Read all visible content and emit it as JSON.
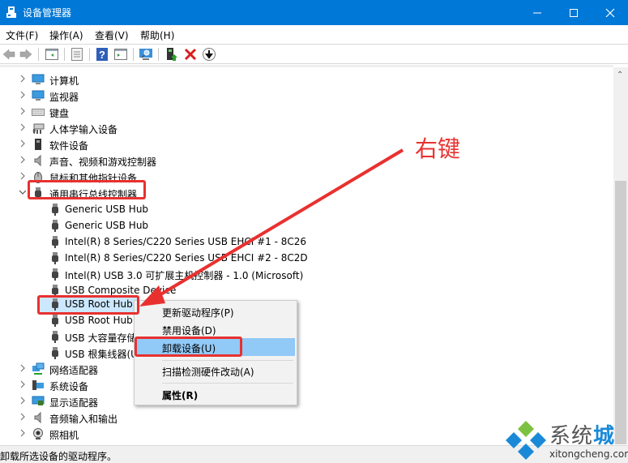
{
  "window": {
    "title": "设备管理器",
    "controls": [
      "minimize",
      "maximize",
      "close"
    ]
  },
  "menubar": {
    "items": [
      {
        "label": "文件(F)"
      },
      {
        "label": "操作(A)"
      },
      {
        "label": "查看(V)"
      },
      {
        "label": "帮助(H)"
      }
    ]
  },
  "toolbar": {
    "buttons": [
      "back-icon",
      "forward-icon",
      "show-hide-console-tree-icon",
      "properties-icon",
      "help-icon",
      "action-pane-icon",
      "scan-hardware-icon",
      "update-driver-icon",
      "uninstall-icon",
      "disable-icon"
    ]
  },
  "tree": {
    "categories_top": [
      {
        "label": "计算机",
        "icon": "computer-icon"
      },
      {
        "label": "监视器",
        "icon": "monitor-icon"
      },
      {
        "label": "键盘",
        "icon": "keyboard-icon"
      },
      {
        "label": "人体学输入设备",
        "icon": "hid-icon"
      },
      {
        "label": "软件设备",
        "icon": "software-device-icon"
      },
      {
        "label": "声音、视频和游戏控制器",
        "icon": "speaker-icon"
      },
      {
        "label": "鼠标和其他指针设备",
        "icon": "mouse-icon"
      }
    ],
    "expanded": {
      "label": "通用串行总线控制器",
      "icon": "usb-icon",
      "children": [
        {
          "label": "Generic USB Hub"
        },
        {
          "label": "Generic USB Hub"
        },
        {
          "label": "Intel(R) 8 Series/C220 Series USB EHCI #1 - 8C26"
        },
        {
          "label": "Intel(R) 8 Series/C220 Series USB EHCI #2 - 8C2D"
        },
        {
          "label": "Intel(R) USB 3.0 可扩展主机控制器 - 1.0 (Microsoft)"
        },
        {
          "label": "USB Composite Device"
        },
        {
          "label": "USB Root Hub",
          "selected": true
        },
        {
          "label": "USB Root Hub"
        },
        {
          "label": "USB 大容量存储设备"
        },
        {
          "label": "USB 根集线器(USB 3.0)"
        }
      ]
    },
    "categories_bottom": [
      {
        "label": "网络适配器",
        "icon": "network-icon"
      },
      {
        "label": "系统设备",
        "icon": "system-device-icon"
      },
      {
        "label": "显示适配器",
        "icon": "display-adapter-icon"
      },
      {
        "label": "音频输入和输出",
        "icon": "speaker-icon"
      },
      {
        "label": "照相机",
        "icon": "camera-icon"
      }
    ]
  },
  "context_menu": {
    "items": [
      {
        "label": "更新驱动程序(P)"
      },
      {
        "label": "禁用设备(D)"
      },
      {
        "label": "卸载设备(U)",
        "highlighted": true
      },
      {
        "label": "扫描检测硬件改动(A)"
      },
      {
        "label": "属性(R)",
        "bold": true
      }
    ]
  },
  "status_bar": {
    "text": "卸载所选设备的驱动程序。"
  },
  "annotation": {
    "text": "右键",
    "color": "#e8312f"
  },
  "watermark": {
    "brand_gray": "系统",
    "brand_blue": "城",
    "url": "xitongcheng.com"
  },
  "colors": {
    "titlebar": "#0078d7",
    "selection": "#cce8ff",
    "menu_highlight": "#91c9f7",
    "annotation_red": "#e8312f"
  }
}
